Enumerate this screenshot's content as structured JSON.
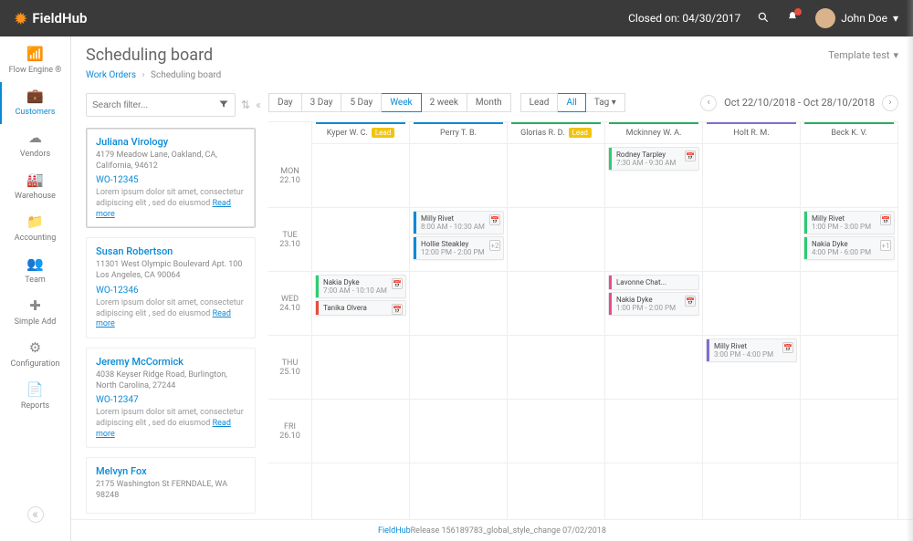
{
  "brand": "FieldHub",
  "closed_label": "Closed on: 04/30/2017",
  "user": {
    "name": "John Doe"
  },
  "sidebar": {
    "items": [
      {
        "label": "Flow Engine ®",
        "icon": "wifi"
      },
      {
        "label": "Customers",
        "icon": "briefcase"
      },
      {
        "label": "Vendors",
        "icon": "cloud"
      },
      {
        "label": "Warehouse",
        "icon": "building"
      },
      {
        "label": "Accounting",
        "icon": "folder"
      },
      {
        "label": "Team",
        "icon": "users"
      },
      {
        "label": "Simple Add",
        "icon": "plus"
      },
      {
        "label": "Configuration",
        "icon": "gears"
      },
      {
        "label": "Reports",
        "icon": "page"
      }
    ]
  },
  "page": {
    "title": "Scheduling board",
    "breadcrumbs": [
      "Work Orders",
      "Scheduling board"
    ],
    "template_label": "Template test"
  },
  "search": {
    "placeholder": "Search filter..."
  },
  "customers": [
    {
      "name": "Juliana Virology",
      "addr": "4179 Meadow Lane, Oakland, CA, California, 94612",
      "wo": "WO-12345",
      "desc": "Lorem ipsum dolor sit amet, consectetur adipiscing elit , sed do eiusmod",
      "readmore": "Read more"
    },
    {
      "name": "Susan Robertson",
      "addr": "11301 West Olympic Boulevard Apt. 100 Los Angeles, CA 90064",
      "wo": "WO-12346",
      "desc": "Lorem ipsum dolor sit amet, consectetur adipiscing elit , sed do eiusmod",
      "readmore": "Read more"
    },
    {
      "name": "Jeremy McCormick",
      "addr": "4038 Keyser Ridge Road, Burlington, North Carolina, 27244",
      "wo": "WO-12347",
      "desc": "Lorem ipsum dolor sit amet, consectetur adipiscing elit , sed do eiusmod",
      "readmore": "Read more"
    },
    {
      "name": "Melvyn Fox",
      "addr": "2175 Washington St FERNDALE, WA 98248",
      "wo": "",
      "desc": "",
      "readmore": ""
    }
  ],
  "toolbar": {
    "views": [
      "Day",
      "3 Day",
      "5 Day",
      "Week",
      "2 week",
      "Month"
    ],
    "active_view": "Week",
    "filters": [
      "Lead",
      "All",
      "Tag"
    ],
    "active_filter": "All",
    "date_range": "Oct 22/10/2018 - Oct 28/10/2018"
  },
  "days": [
    {
      "dow": "MON",
      "date": "22.10"
    },
    {
      "dow": "TUE",
      "date": "23.10"
    },
    {
      "dow": "WED",
      "date": "24.10"
    },
    {
      "dow": "THU",
      "date": "25.10"
    },
    {
      "dow": "FRI",
      "date": "26.10"
    }
  ],
  "persons": [
    {
      "name": "Kyper W. C.",
      "lead": true,
      "stripe": "#0a8ad6"
    },
    {
      "name": "Perry T. B.",
      "lead": false,
      "stripe": "#0a8ad6"
    },
    {
      "name": "Glorias R. D.",
      "lead": true,
      "stripe": "#27ae60"
    },
    {
      "name": "Mckinney W. A.",
      "lead": false,
      "stripe": "#27ae60"
    },
    {
      "name": "Holt R. M.",
      "lead": false,
      "stripe": "#7f6fd4"
    },
    {
      "name": "Beck K. V.",
      "lead": false,
      "stripe": "#27ae60"
    }
  ],
  "events": [
    {
      "person": 3,
      "day": 0,
      "name": "Rodney Tarpley",
      "time": "7:30 AM - 9:30 AM",
      "color": "#2ecc71",
      "calicon": true
    },
    {
      "person": 1,
      "day": 1,
      "name": "Milly Rivet",
      "time": "8:00 AM - 10:30 AM",
      "color": "#0a8ad6",
      "calicon": true
    },
    {
      "person": 1,
      "day": 1,
      "name": "Hollie Steakley",
      "time": "12:00 PM - 2:00 PM",
      "color": "#0a8ad6",
      "badge": "+2"
    },
    {
      "person": 5,
      "day": 1,
      "name": "Milly Rivet",
      "time": "1:00 PM - 3:00 PM",
      "color": "#2ecc71",
      "calicon": true
    },
    {
      "person": 5,
      "day": 1,
      "name": "Nakia Dyke",
      "time": "4:00 PM - 6:00 PM",
      "color": "#2ecc71",
      "badge": "+1"
    },
    {
      "person": 0,
      "day": 2,
      "name": "Nakia Dyke",
      "time": "7:00 AM - 10:10 AM",
      "color": "#2ecc71",
      "calicon": true
    },
    {
      "person": 0,
      "day": 2,
      "name": "Tanika Olvera",
      "time": "",
      "color": "#e74c3c",
      "calicon": true
    },
    {
      "person": 3,
      "day": 2,
      "name": "Lavonne Chat...",
      "time": "",
      "color": "#e74c90"
    },
    {
      "person": 3,
      "day": 2,
      "name": "Nakia Dyke",
      "time": "1:00 PM - 2:00 PM",
      "color": "#e74c90",
      "calicon": true
    },
    {
      "person": 4,
      "day": 3,
      "name": "Milly Rivet",
      "time": "3:00 PM - 4:00 PM",
      "color": "#7f6fd4",
      "calicon": true
    }
  ],
  "footer": {
    "brand": "FieldHub",
    "release": " Release 156189783_global_style_change 07/02/2018"
  }
}
